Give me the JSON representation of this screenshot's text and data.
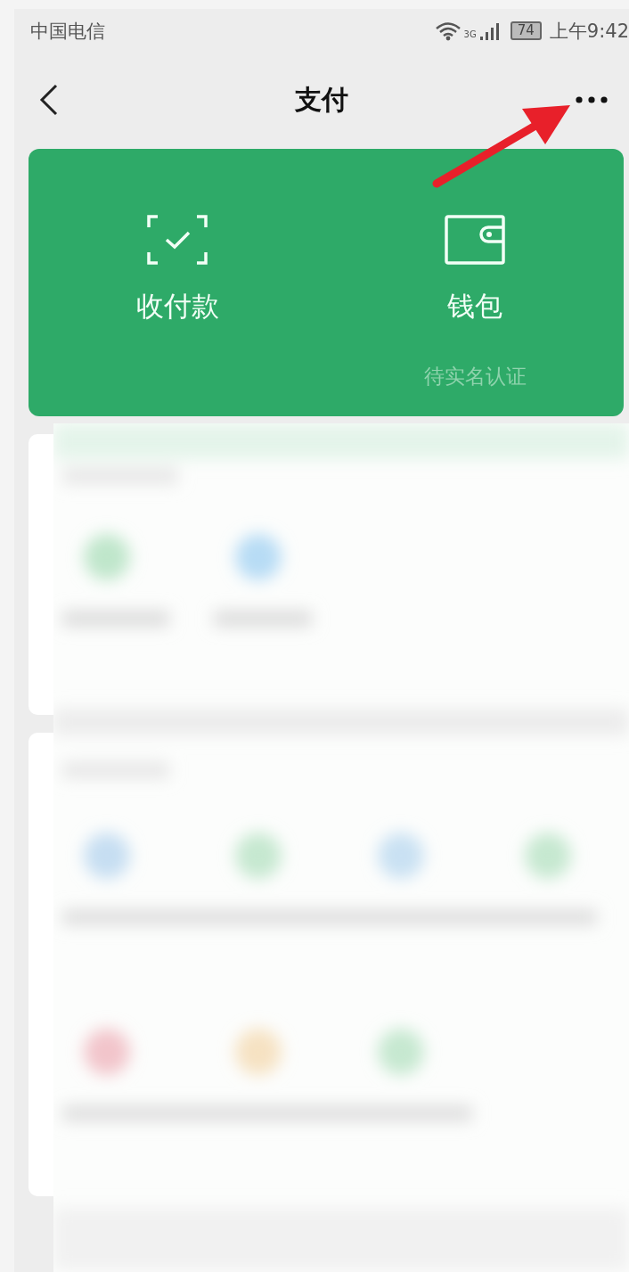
{
  "status_bar": {
    "carrier": "中国电信",
    "network": "3G",
    "battery": "74",
    "time": "上午9:42"
  },
  "nav": {
    "title": "支付"
  },
  "actions": [
    {
      "label": "收付款",
      "kind": "scan"
    },
    {
      "label": "钱包",
      "kind": "wallet",
      "note": "待实名认证"
    }
  ]
}
